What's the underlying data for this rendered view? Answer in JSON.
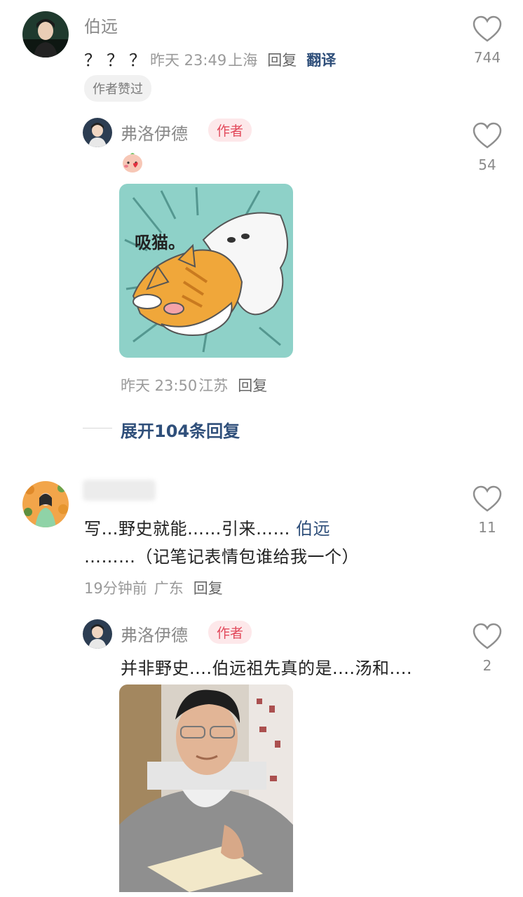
{
  "comment1": {
    "username": "伯远",
    "text": "？？？",
    "time": "昨天 23:49",
    "location": "上海",
    "reply_label": "回复",
    "translate_label": "翻译",
    "author_liked_chip": "作者赞过",
    "like_count": "744",
    "reply": {
      "username": "弗洛伊德",
      "badge": "作者",
      "sticker_text": "吸猫。",
      "time": "昨天 23:50",
      "location": "江苏",
      "reply_label": "回复",
      "like_count": "54"
    },
    "expand_label": "展开104条回复"
  },
  "comment2": {
    "text_part1": "写…野史就能……引来…… ",
    "mention": "伯远",
    "text_part2": "………（记笔记表情包谁给我一个）",
    "time": "19分钟前",
    "location": "广东",
    "reply_label": "回复",
    "like_count": "11",
    "reply": {
      "username": "弗洛伊德",
      "badge": "作者",
      "text": "并非野史....伯远祖先真的是....汤和....",
      "like_count": "2"
    }
  },
  "colors": {
    "link": "#2f4f7a",
    "badge_text": "#e2495b",
    "badge_bg": "#fde8ea",
    "sticker_bg": "#8ed1c8",
    "cat_orange": "#f0a73a"
  }
}
